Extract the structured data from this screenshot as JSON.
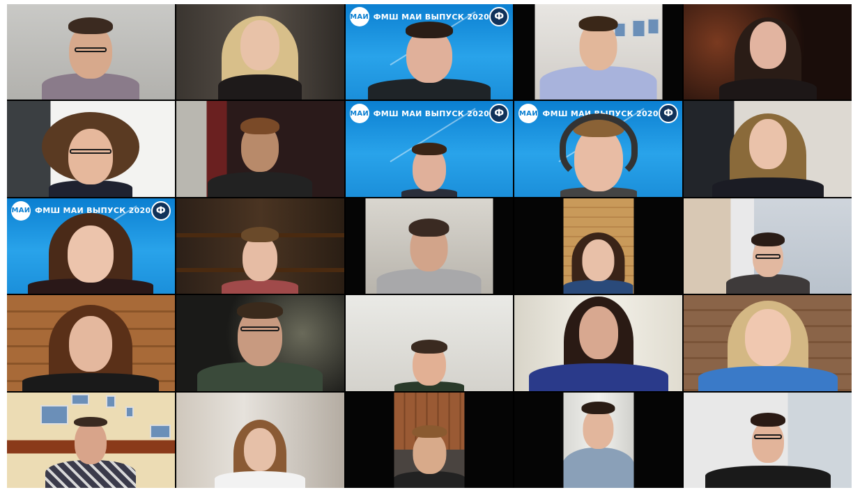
{
  "meeting": {
    "view": "gallery",
    "branding": {
      "text": "ФМШ МАИ ВЫПУСК 2020",
      "logo_left": "МАИ",
      "logo_right": "ФМШ",
      "color_top": "#0b7fd1",
      "color_bottom": "#29a3ea"
    },
    "participants_visible": 25
  }
}
